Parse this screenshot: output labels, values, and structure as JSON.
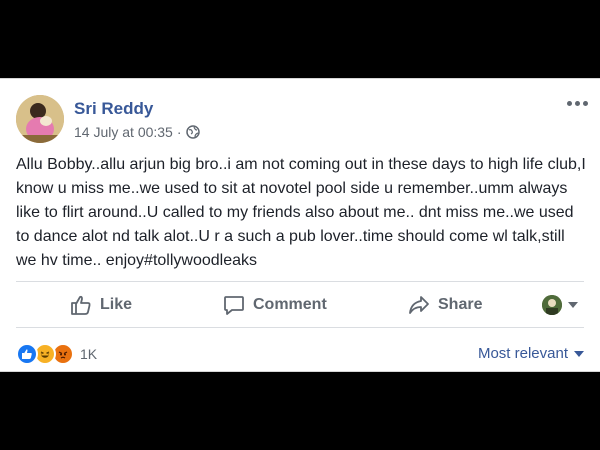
{
  "post": {
    "author": "Sri Reddy",
    "timestamp": "14 July at 00:35",
    "separator": "·",
    "privacy_icon": "globe-icon",
    "text": "Allu Bobby..allu arjun big bro..i am not coming out in these days to high life club,I know u miss me..we used to sit at novotel pool side u remember..umm always like to flirt around..U called to my friends also about me.. dnt miss me..we used to dance alot nd talk alot..U r a such a pub lover..time should come wl talk,still we hv time.. enjoy#tollywoodleaks"
  },
  "actions": {
    "like_label": "Like",
    "comment_label": "Comment",
    "share_label": "Share"
  },
  "reactions": {
    "icons": [
      "like-reaction-icon",
      "haha-reaction-icon",
      "angry-reaction-icon"
    ],
    "count": "1K"
  },
  "comments": {
    "sort_label": "Most relevant"
  },
  "colors": {
    "brand_blue": "#385898",
    "text": "#1d2129",
    "muted": "#606770",
    "like_blue": "#1877f2",
    "angry_orange": "#e9710f",
    "haha_yellow": "#f7b125"
  }
}
